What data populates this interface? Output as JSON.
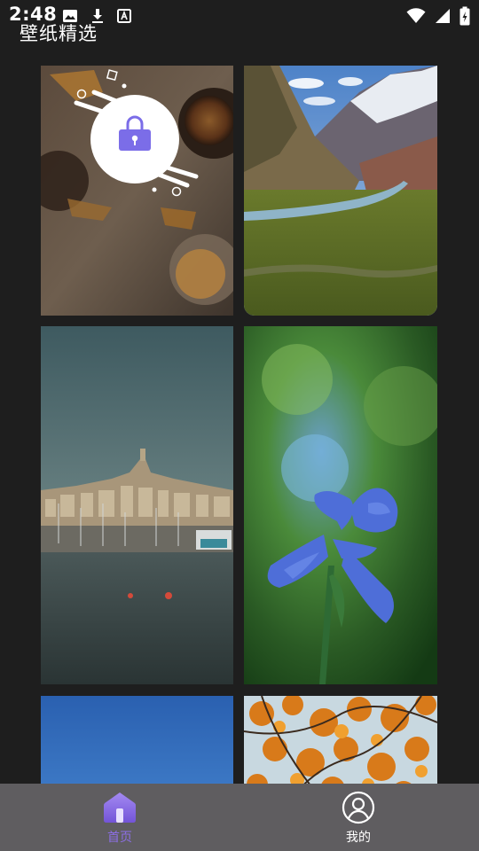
{
  "status_bar": {
    "time": "2:48",
    "left_icons": [
      "image-icon",
      "download-icon",
      "a-box-icon"
    ],
    "right_icons": [
      "wifi-icon",
      "signal-icon",
      "battery-icon"
    ]
  },
  "app": {
    "title": "壁纸精选"
  },
  "wallpapers": [
    {
      "id": "tile-1",
      "subject": "tea-table-with-lock-overlay"
    },
    {
      "id": "tile-2",
      "subject": "mountain-valley"
    },
    {
      "id": "tile-3",
      "subject": "harbor-city"
    },
    {
      "id": "tile-4",
      "subject": "blue-iris"
    },
    {
      "id": "tile-5",
      "subject": "blue-sky"
    },
    {
      "id": "tile-6",
      "subject": "autumn-leaves"
    }
  ],
  "bottom_nav": {
    "items": [
      {
        "label": "首页",
        "icon": "home-icon",
        "active": true
      },
      {
        "label": "我的",
        "icon": "user-icon",
        "active": false
      }
    ]
  },
  "colors": {
    "background": "#1e1e1e",
    "nav_background": "#5f5d60",
    "accent": "#8c6ee6"
  }
}
